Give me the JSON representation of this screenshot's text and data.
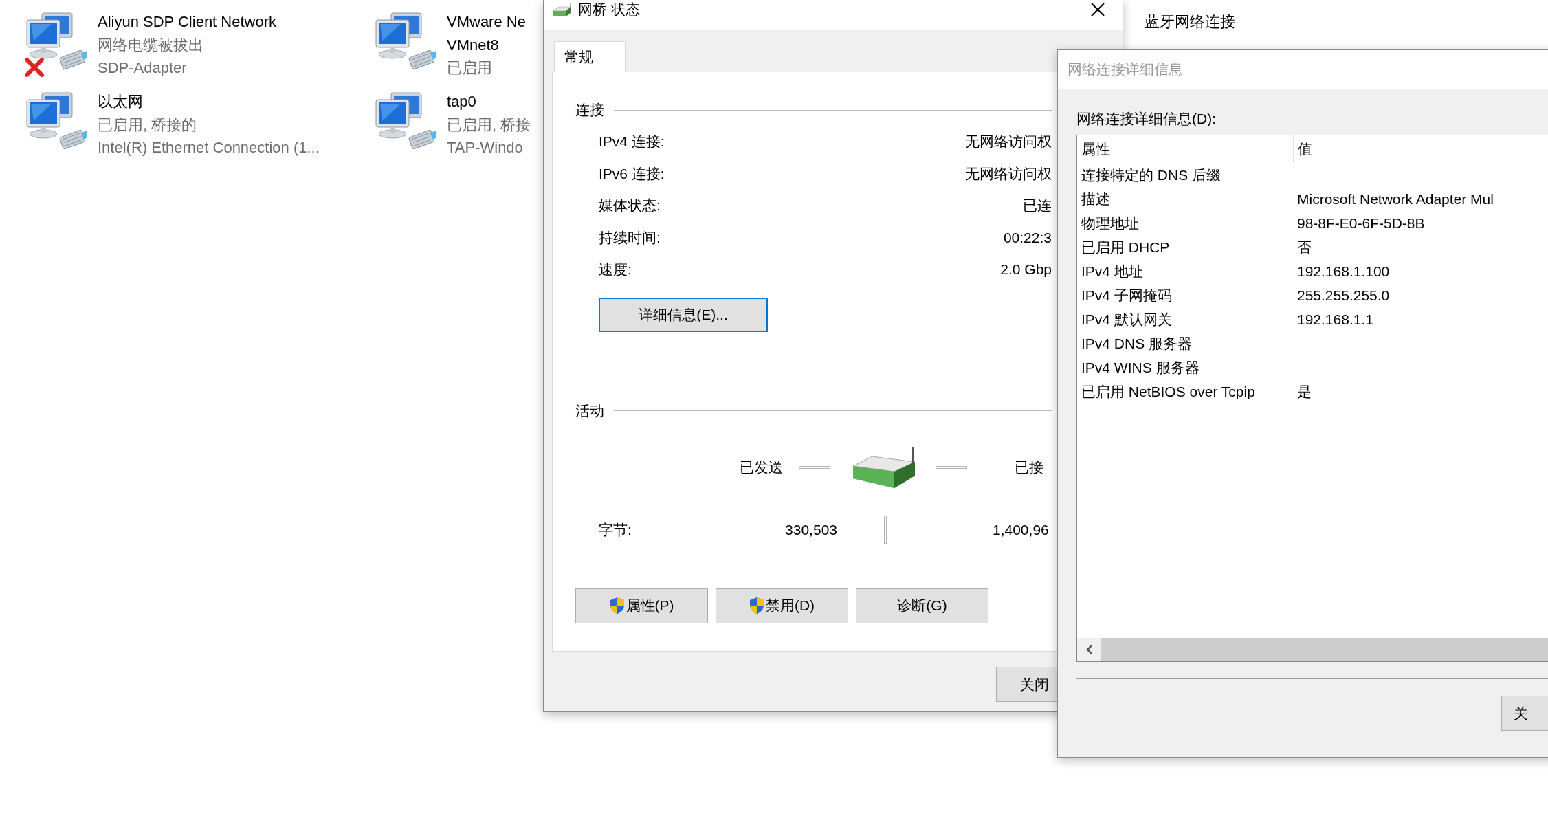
{
  "explorer": {
    "items": [
      {
        "kind": "network",
        "name_lines": [
          "Aliyun SDP Client Network"
        ],
        "details": [
          "网络电缆被拔出",
          "SDP-Adapter"
        ],
        "disconnected": true
      },
      {
        "kind": "network",
        "name_lines": [
          "VMware Ne",
          "VMnet8"
        ],
        "details": [
          "已启用"
        ],
        "disconnected": false
      },
      {
        "kind": "bluetooth",
        "name_lines": [
          "蓝牙网络连接"
        ],
        "disconnected": false
      },
      {
        "kind": "network",
        "name_lines": [
          "以太网"
        ],
        "details": [
          "已启用, 桥接的",
          "Intel(R) Ethernet Connection (1..."
        ],
        "disconnected": false
      },
      {
        "kind": "network",
        "name_lines": [
          "tap0"
        ],
        "details": [
          "已启用, 桥接",
          "TAP-Windo"
        ],
        "disconnected": false
      }
    ]
  },
  "status_dialog": {
    "title": "网桥 状态",
    "tabs": [
      {
        "label": "常规",
        "selected": true
      }
    ],
    "connection": {
      "heading": "连接",
      "rows": [
        {
          "label": "IPv4 连接:",
          "value": "无网络访问权"
        },
        {
          "label": "IPv6 连接:",
          "value": "无网络访问权"
        },
        {
          "label": "媒体状态:",
          "value": "已连"
        },
        {
          "label": "持续时间:",
          "value": "00:22:3"
        },
        {
          "label": "速度:",
          "value": "2.0 Gbp"
        }
      ]
    },
    "details_button": {
      "label": "详细信息(E)...",
      "focused": true
    },
    "activity": {
      "heading": "活动",
      "sent_label": "已发送",
      "received_label": "已接",
      "bytes_label": "字节:",
      "bytes_sent": "330,503",
      "bytes_received": "1,400,96"
    },
    "buttons": [
      {
        "label": "属性(P)",
        "shield": true
      },
      {
        "label": "禁用(D)",
        "shield": true
      },
      {
        "label": "诊断(G)",
        "shield": false
      }
    ],
    "close_button": "关闭"
  },
  "details_window": {
    "title": "网络连接详细信息",
    "list_label": "网络连接详细信息(D):",
    "columns": [
      "属性",
      "值"
    ],
    "rows": [
      {
        "property": "连接特定的 DNS 后缀"
      },
      {
        "property": "描述",
        "value": "Microsoft Network Adapter Mul"
      },
      {
        "property": "物理地址",
        "value": "98-8F-E0-6F-5D-8B"
      },
      {
        "property": "已启用 DHCP",
        "value": "否"
      },
      {
        "property": "IPv4 地址",
        "value": "192.168.1.100"
      },
      {
        "property": "IPv4 子网掩码",
        "value": "255.255.255.0"
      },
      {
        "property": "IPv4 默认网关",
        "value": "192.168.1.1"
      },
      {
        "property": "IPv4 DNS 服务器"
      },
      {
        "property": "IPv4 WINS 服务器"
      },
      {
        "property": "已启用 NetBIOS over Tcpip",
        "value": "是"
      }
    ],
    "close_button": "关"
  }
}
